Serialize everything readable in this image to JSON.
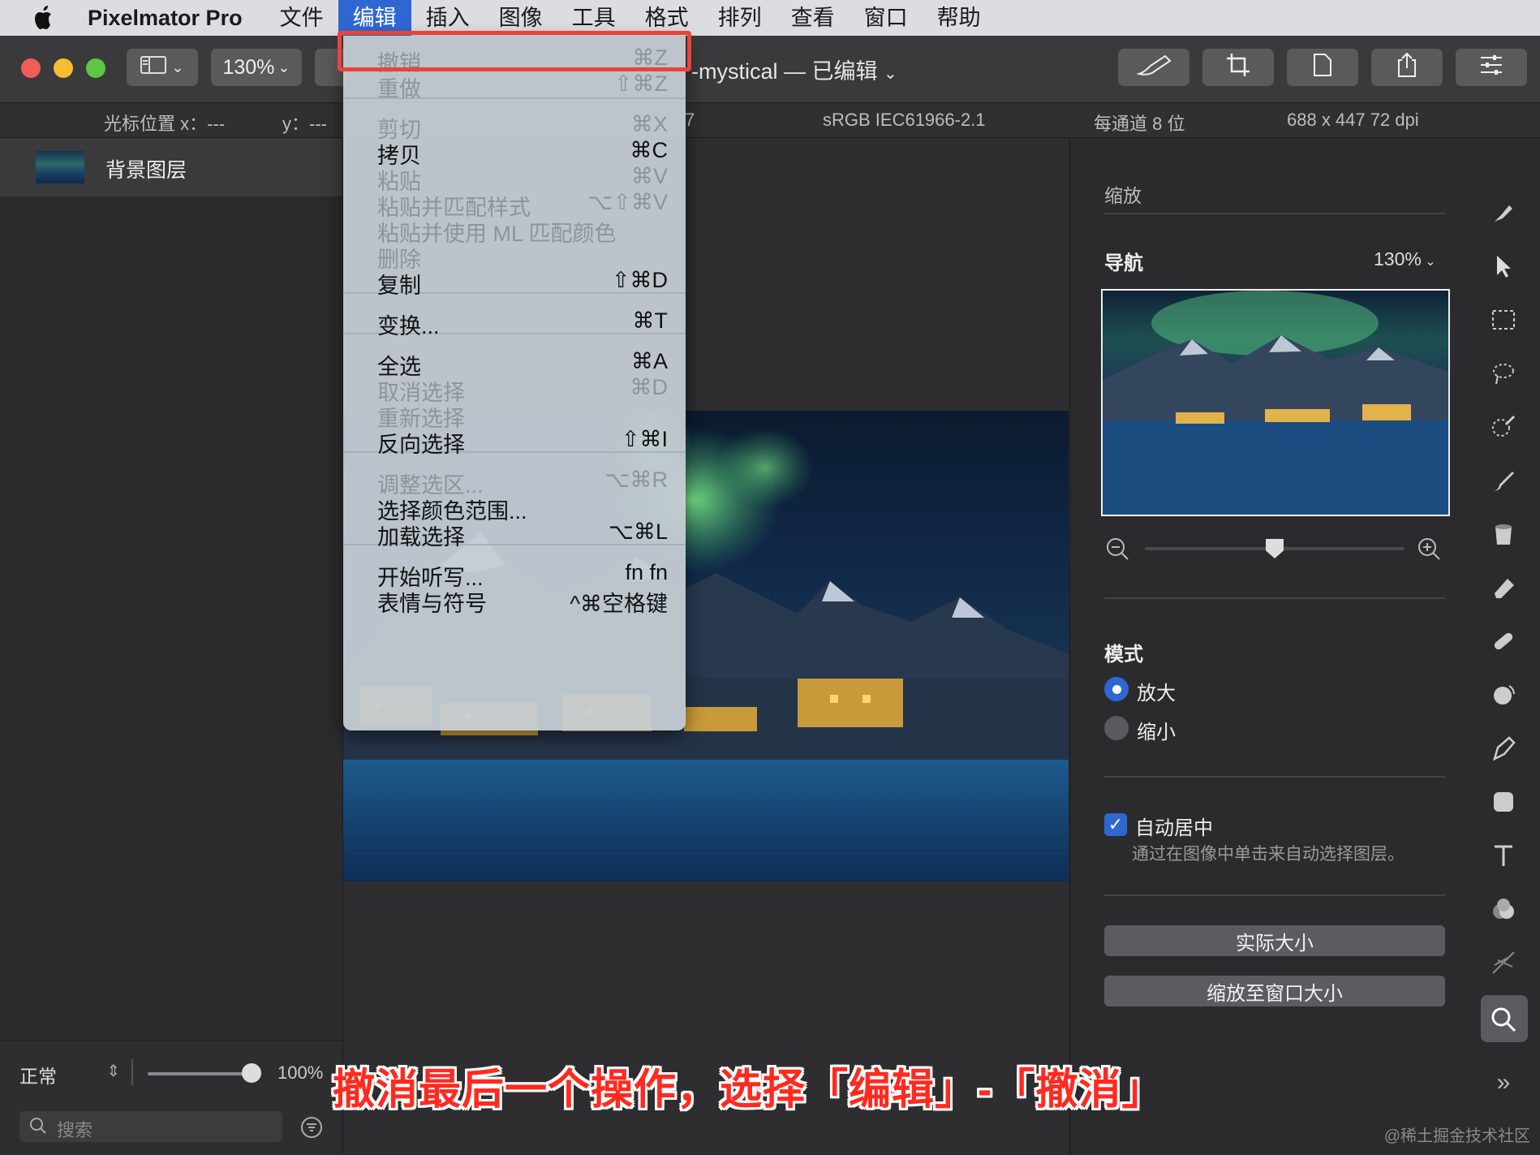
{
  "menubar": {
    "app_name": "Pixelmator Pro",
    "items": [
      "文件",
      "编辑",
      "插入",
      "图像",
      "工具",
      "格式",
      "排列",
      "查看",
      "窗口",
      "帮助"
    ],
    "active_item": "编辑"
  },
  "toolbar": {
    "zoom": "130%",
    "doc_title": "mystical — 已编辑",
    "doc_title_prefix": "-"
  },
  "infobar": {
    "cursor_x": "光标位置 x：---",
    "cursor_y": "y：---",
    "partial": "7",
    "color_profile": "sRGB IEC61966-2.1",
    "bit_depth": "每通道 8 位",
    "dimensions": "688 x 447 72 dpi"
  },
  "layers": {
    "items": [
      {
        "name": "背景图层"
      }
    ]
  },
  "sidebar_bottom": {
    "blend_mode": "正常",
    "opacity": "100%",
    "opacity_value": 1.0,
    "search_placeholder": "搜索"
  },
  "edit_menu": {
    "items": [
      {
        "label": "撤销",
        "shortcut": "⌘Z",
        "enabled": false
      },
      {
        "label": "重做",
        "shortcut": "⇧⌘Z",
        "enabled": false
      },
      {
        "label": "剪切",
        "shortcut": "⌘X",
        "enabled": false
      },
      {
        "label": "拷贝",
        "shortcut": "⌘C",
        "enabled": true
      },
      {
        "label": "粘贴",
        "shortcut": "⌘V",
        "enabled": false
      },
      {
        "label": "粘贴并匹配样式",
        "shortcut": "⌥⇧⌘V",
        "enabled": false
      },
      {
        "label": "粘贴并使用 ML 匹配颜色",
        "shortcut": "",
        "enabled": false
      },
      {
        "label": "删除",
        "shortcut": "",
        "enabled": false
      },
      {
        "label": "复制",
        "shortcut": "⇧⌘D",
        "enabled": true
      },
      {
        "label": "变换...",
        "shortcut": "⌘T",
        "enabled": true
      },
      {
        "label": "全选",
        "shortcut": "⌘A",
        "enabled": true
      },
      {
        "label": "取消选择",
        "shortcut": "⌘D",
        "enabled": false
      },
      {
        "label": "重新选择",
        "shortcut": "",
        "enabled": false
      },
      {
        "label": "反向选择",
        "shortcut": "⇧⌘I",
        "enabled": true
      },
      {
        "label": "调整选区...",
        "shortcut": "⌥⌘R",
        "enabled": false
      },
      {
        "label": "选择颜色范围...",
        "shortcut": "",
        "enabled": true
      },
      {
        "label": "加载选择",
        "shortcut": "⌥⌘L",
        "enabled": true
      },
      {
        "label": "开始听写...",
        "shortcut": "fn fn",
        "enabled": true
      },
      {
        "label": "表情与符号",
        "shortcut": "^⌘空格键",
        "enabled": true
      }
    ]
  },
  "right_panel": {
    "zoom_header": "缩放",
    "nav_label": "导航",
    "nav_zoom": "130%",
    "slider_value": 0.5,
    "mode_label": "模式",
    "mode_options": [
      "放大",
      "缩小"
    ],
    "mode_selected": "放大",
    "auto_center_label": "自动居中",
    "auto_center_checked": true,
    "auto_center_desc": "通过在图像中单击来自动选择图层。",
    "actual_size_button": "实际大小",
    "fit_window_button": "缩放至窗口大小"
  },
  "caption": "撤消最后一个操作，选择「编辑」-「撤消」",
  "watermark": "@稀土掘金技术社区",
  "colors": {
    "accent": "#2f67d2",
    "highlight_box": "#e8443a",
    "caption": "#ff2a1f"
  }
}
